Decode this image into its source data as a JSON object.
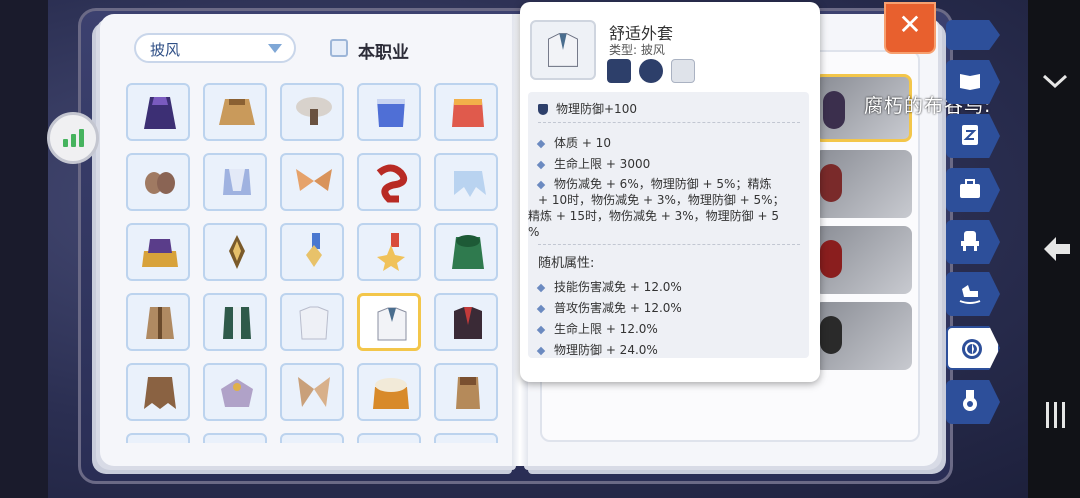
{
  "game": {
    "filter": {
      "label": "披风"
    },
    "job_filter": {
      "label": "本职业"
    },
    "close_label": "✕",
    "overlay_name": "腐朽的布谷鸟:",
    "tooltip": {
      "name": "舒适外套",
      "type": "类型: 披风",
      "base_stat": "物理防御+100",
      "stats": [
        "体质 + 10",
        "生命上限 + 3000"
      ],
      "refine_text_1": "物伤减免 + 6%，物理防御 + 5%；精炼",
      "refine_text_2": "+ 10时，物伤减免 + 3%，物理防御 + 5%；",
      "refine_text_3": "精炼 + 15时，物伤减免 + 3%，物理防御 + 5",
      "refine_text_4": "%",
      "random_title": "随机属性:",
      "random_stats": [
        "技能伤害减免 + 12.0%",
        "普攻伤害减免 + 12.0%",
        "生命上限 + 12.0%",
        "物理防御 + 24.0%"
      ]
    },
    "colors": {
      "accent": "#e8602e",
      "tab": "#2d4f9a",
      "selected": "#f3c64a"
    }
  }
}
